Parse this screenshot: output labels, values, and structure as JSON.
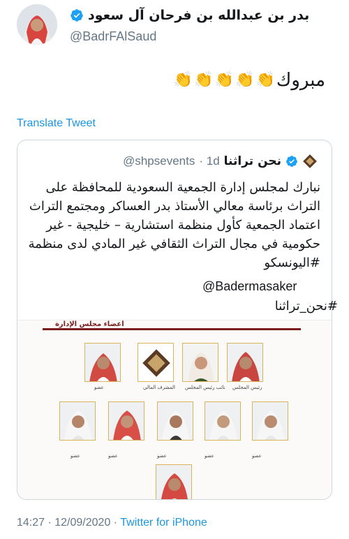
{
  "tweet": {
    "display_name": "بدر بن عبدالله بن فرحان آل سعود",
    "handle": "@BadrFAlSaud",
    "text": "مبروك",
    "emoji": "👏",
    "translate_label": "Translate Tweet",
    "timestamp": "14:27 · 12/09/2020 · ",
    "source": "Twitter for iPhone"
  },
  "quote": {
    "display_name": "نحن تراثنا",
    "handle": "@shpsevents",
    "age": "· 1d",
    "body": "نبارك لمجلس إدارة الجمعية السعودية للمحافظة على التراث برئاسة معالي الأستاذ بدر العساكر ومجتمع التراث اعتماد الجمعية كأول منظمة استشارية – خليجية - غير حكومية في مجال التراث الثقافي غير المادي لدى منظمة #اليونسكو",
    "mention": "@Badermasaker",
    "hashtag": "#نحن_تراثنا",
    "image": {
      "title": "أعضاء مجلس الإدارة",
      "roles": {
        "president": "رئيس المجلس",
        "vice": "نائب رئيس المجلس",
        "supervisor": "المشرف المالي",
        "member": "عضو"
      }
    }
  },
  "colors": {
    "link": "#1b95e0",
    "muted": "#657786",
    "border": "#ccd6dd",
    "accent": "#7a1c1c"
  }
}
